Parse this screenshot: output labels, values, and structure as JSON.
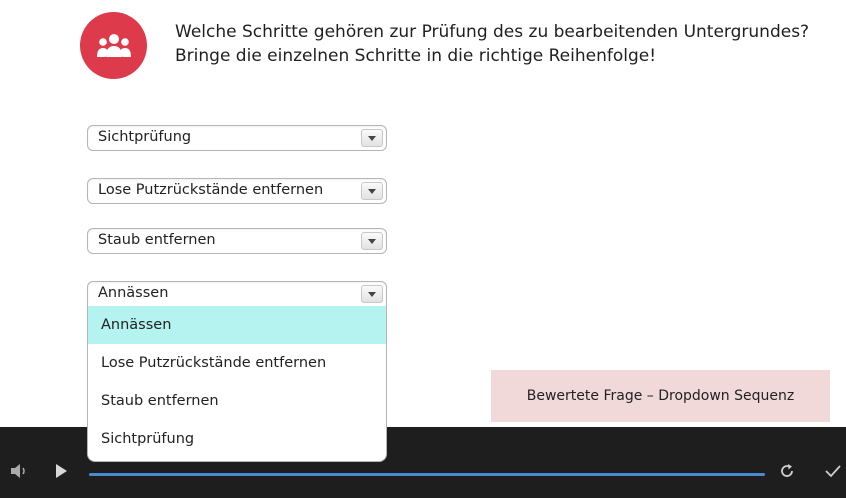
{
  "question": {
    "line1": "Welche Schritte gehören zur Prüfung des zu bearbeitenden Untergrundes?",
    "line2": "Bringe die einzelnen Schritte in die richtige Reihenfolge!"
  },
  "selects": [
    {
      "value": "Sichtprüfung"
    },
    {
      "value": "Lose Putzrückstände entfernen"
    },
    {
      "value": "Staub entfernen"
    },
    {
      "value": "Annässen"
    }
  ],
  "dropdown": {
    "options": [
      "Annässen",
      "Lose Putzrückstände entfernen",
      "Staub entfernen",
      "Sichtprüfung"
    ],
    "highlighted": "Annässen"
  },
  "badge": {
    "label": "Bewertete Frage – Dropdown Sequenz"
  },
  "player": {
    "progress": 1.0
  },
  "colors": {
    "accent_red": "#dd3a4b",
    "highlight_cyan": "#b4f3f0",
    "badge_bg": "#f2d9d9",
    "player_bg": "#1e1e1e",
    "progress_blue": "#4a8ad0"
  },
  "icons": [
    "group-icon",
    "chevron-down-icon",
    "volume-icon",
    "play-icon",
    "replay-icon",
    "check-icon"
  ]
}
